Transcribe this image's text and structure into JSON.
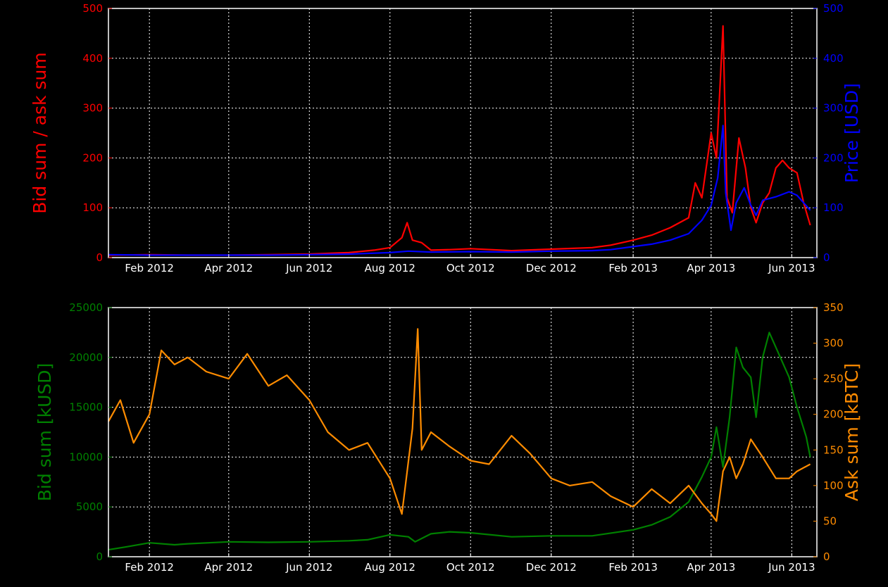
{
  "colors": {
    "background": "#000000",
    "frame": "#ffffff",
    "bid_ask_ratio": "#ff0000",
    "price": "#0000ff",
    "bid_sum": "#008000",
    "ask_sum": "#ff8c00",
    "grid": "#ffffff"
  },
  "chart_data": [
    {
      "type": "line",
      "ylabel_left": "Bid sum / ask sum",
      "ylabel_right": "Price [USD]",
      "x_tick_labels": [
        "Feb 2012",
        "Apr 2012",
        "Jun 2012",
        "Aug 2012",
        "Oct 2012",
        "Dec 2012",
        "Feb 2013",
        "Apr 2013",
        "Jun 2013"
      ],
      "x_ticks": [
        "2012-02-01",
        "2012-04-01",
        "2012-06-01",
        "2012-08-01",
        "2012-10-01",
        "2012-12-01",
        "2013-02-01",
        "2013-04-01",
        "2013-06-01"
      ],
      "xlim": [
        "2012-01-01",
        "2013-06-20"
      ],
      "ylim_left": [
        0,
        500
      ],
      "ylim_right": [
        0,
        500
      ],
      "y_ticks_left": [
        0,
        100,
        200,
        300,
        400,
        500
      ],
      "y_ticks_right": [
        0,
        100,
        200,
        300,
        400,
        500
      ],
      "grid": true,
      "series": [
        {
          "axis": "left",
          "color": "#ff0000",
          "points": [
            [
              "2012-01-01",
              5
            ],
            [
              "2012-02-01",
              6
            ],
            [
              "2012-03-01",
              5
            ],
            [
              "2012-04-01",
              5
            ],
            [
              "2012-05-01",
              6
            ],
            [
              "2012-06-01",
              7
            ],
            [
              "2012-07-01",
              10
            ],
            [
              "2012-07-20",
              15
            ],
            [
              "2012-08-01",
              20
            ],
            [
              "2012-08-10",
              40
            ],
            [
              "2012-08-14",
              70
            ],
            [
              "2012-08-18",
              35
            ],
            [
              "2012-08-25",
              30
            ],
            [
              "2012-09-01",
              15
            ],
            [
              "2012-09-15",
              16
            ],
            [
              "2012-10-01",
              18
            ],
            [
              "2012-11-01",
              14
            ],
            [
              "2012-12-01",
              17
            ],
            [
              "2013-01-01",
              20
            ],
            [
              "2013-01-15",
              25
            ],
            [
              "2013-02-01",
              35
            ],
            [
              "2013-02-15",
              45
            ],
            [
              "2013-03-01",
              60
            ],
            [
              "2013-03-15",
              80
            ],
            [
              "2013-03-20",
              150
            ],
            [
              "2013-03-25",
              120
            ],
            [
              "2013-04-01",
              250
            ],
            [
              "2013-04-05",
              200
            ],
            [
              "2013-04-10",
              465
            ],
            [
              "2013-04-13",
              120
            ],
            [
              "2013-04-17",
              90
            ],
            [
              "2013-04-22",
              240
            ],
            [
              "2013-04-27",
              180
            ],
            [
              "2013-05-01",
              100
            ],
            [
              "2013-05-05",
              70
            ],
            [
              "2013-05-10",
              110
            ],
            [
              "2013-05-15",
              130
            ],
            [
              "2013-05-20",
              180
            ],
            [
              "2013-05-25",
              195
            ],
            [
              "2013-05-30",
              180
            ],
            [
              "2013-06-05",
              170
            ],
            [
              "2013-06-10",
              110
            ],
            [
              "2013-06-15",
              65
            ]
          ]
        },
        {
          "axis": "right",
          "color": "#0000ff",
          "points": [
            [
              "2012-01-01",
              6
            ],
            [
              "2012-02-01",
              5
            ],
            [
              "2012-03-01",
              5
            ],
            [
              "2012-04-01",
              5
            ],
            [
              "2012-05-01",
              5
            ],
            [
              "2012-06-01",
              6
            ],
            [
              "2012-07-01",
              7
            ],
            [
              "2012-08-01",
              10
            ],
            [
              "2012-08-15",
              13
            ],
            [
              "2012-09-01",
              11
            ],
            [
              "2012-10-01",
              12
            ],
            [
              "2012-11-01",
              11
            ],
            [
              "2012-12-01",
              13
            ],
            [
              "2013-01-01",
              14
            ],
            [
              "2013-01-15",
              16
            ],
            [
              "2013-02-01",
              22
            ],
            [
              "2013-02-15",
              27
            ],
            [
              "2013-03-01",
              35
            ],
            [
              "2013-03-15",
              48
            ],
            [
              "2013-03-25",
              75
            ],
            [
              "2013-04-01",
              105
            ],
            [
              "2013-04-06",
              160
            ],
            [
              "2013-04-10",
              265
            ],
            [
              "2013-04-12",
              130
            ],
            [
              "2013-04-16",
              55
            ],
            [
              "2013-04-20",
              110
            ],
            [
              "2013-04-26",
              140
            ],
            [
              "2013-05-01",
              105
            ],
            [
              "2013-05-05",
              85
            ],
            [
              "2013-05-10",
              115
            ],
            [
              "2013-05-20",
              122
            ],
            [
              "2013-05-30",
              132
            ],
            [
              "2013-06-05",
              125
            ],
            [
              "2013-06-10",
              110
            ],
            [
              "2013-06-15",
              95
            ]
          ]
        }
      ]
    },
    {
      "type": "line",
      "ylabel_left": "Bid sum [kUSD]",
      "ylabel_right": "Ask sum [kBTC]",
      "x_tick_labels": [
        "Feb 2012",
        "Apr 2012",
        "Jun 2012",
        "Aug 2012",
        "Oct 2012",
        "Dec 2012",
        "Feb 2013",
        "Apr 2013",
        "Jun 2013"
      ],
      "x_ticks": [
        "2012-02-01",
        "2012-04-01",
        "2012-06-01",
        "2012-08-01",
        "2012-10-01",
        "2012-12-01",
        "2013-02-01",
        "2013-04-01",
        "2013-06-01"
      ],
      "xlim": [
        "2012-01-01",
        "2013-06-20"
      ],
      "ylim_left": [
        0,
        25000
      ],
      "ylim_right": [
        0,
        350
      ],
      "y_ticks_left": [
        0,
        5000,
        10000,
        15000,
        20000,
        25000
      ],
      "y_ticks_right": [
        0,
        50,
        100,
        150,
        200,
        250,
        300,
        350
      ],
      "grid": true,
      "series": [
        {
          "axis": "left",
          "color": "#008000",
          "points": [
            [
              "2012-01-01",
              700
            ],
            [
              "2012-01-15",
              1000
            ],
            [
              "2012-02-01",
              1400
            ],
            [
              "2012-02-20",
              1200
            ],
            [
              "2012-03-01",
              1300
            ],
            [
              "2012-04-01",
              1500
            ],
            [
              "2012-05-01",
              1450
            ],
            [
              "2012-06-01",
              1500
            ],
            [
              "2012-07-01",
              1600
            ],
            [
              "2012-07-15",
              1700
            ],
            [
              "2012-08-01",
              2200
            ],
            [
              "2012-08-15",
              2000
            ],
            [
              "2012-08-20",
              1500
            ],
            [
              "2012-09-01",
              2300
            ],
            [
              "2012-09-15",
              2500
            ],
            [
              "2012-10-01",
              2400
            ],
            [
              "2012-11-01",
              2000
            ],
            [
              "2012-12-01",
              2100
            ],
            [
              "2013-01-01",
              2100
            ],
            [
              "2013-02-01",
              2700
            ],
            [
              "2013-02-15",
              3200
            ],
            [
              "2013-03-01",
              4000
            ],
            [
              "2013-03-15",
              5500
            ],
            [
              "2013-03-25",
              8000
            ],
            [
              "2013-04-01",
              10000
            ],
            [
              "2013-04-05",
              13000
            ],
            [
              "2013-04-10",
              9000
            ],
            [
              "2013-04-15",
              14000
            ],
            [
              "2013-04-20",
              21000
            ],
            [
              "2013-04-25",
              19000
            ],
            [
              "2013-05-01",
              18000
            ],
            [
              "2013-05-05",
              14000
            ],
            [
              "2013-05-10",
              20000
            ],
            [
              "2013-05-15",
              22500
            ],
            [
              "2013-05-20",
              21000
            ],
            [
              "2013-05-30",
              18000
            ],
            [
              "2013-06-05",
              15000
            ],
            [
              "2013-06-12",
              12000
            ],
            [
              "2013-06-15",
              10000
            ]
          ]
        },
        {
          "axis": "right",
          "color": "#ff8c00",
          "points": [
            [
              "2012-01-01",
              190
            ],
            [
              "2012-01-10",
              220
            ],
            [
              "2012-01-20",
              160
            ],
            [
              "2012-02-01",
              200
            ],
            [
              "2012-02-10",
              290
            ],
            [
              "2012-02-20",
              270
            ],
            [
              "2012-03-01",
              280
            ],
            [
              "2012-03-15",
              260
            ],
            [
              "2012-04-01",
              250
            ],
            [
              "2012-04-15",
              285
            ],
            [
              "2012-05-01",
              240
            ],
            [
              "2012-05-15",
              255
            ],
            [
              "2012-06-01",
              220
            ],
            [
              "2012-06-15",
              175
            ],
            [
              "2012-07-01",
              150
            ],
            [
              "2012-07-15",
              160
            ],
            [
              "2012-08-01",
              110
            ],
            [
              "2012-08-10",
              60
            ],
            [
              "2012-08-18",
              180
            ],
            [
              "2012-08-22",
              320
            ],
            [
              "2012-08-25",
              150
            ],
            [
              "2012-09-01",
              175
            ],
            [
              "2012-09-15",
              155
            ],
            [
              "2012-10-01",
              135
            ],
            [
              "2012-10-15",
              130
            ],
            [
              "2012-11-01",
              170
            ],
            [
              "2012-11-15",
              145
            ],
            [
              "2012-12-01",
              110
            ],
            [
              "2012-12-15",
              100
            ],
            [
              "2013-01-01",
              105
            ],
            [
              "2013-01-15",
              85
            ],
            [
              "2013-02-01",
              70
            ],
            [
              "2013-02-15",
              95
            ],
            [
              "2013-03-01",
              75
            ],
            [
              "2013-03-15",
              100
            ],
            [
              "2013-03-25",
              75
            ],
            [
              "2013-04-01",
              60
            ],
            [
              "2013-04-05",
              50
            ],
            [
              "2013-04-10",
              120
            ],
            [
              "2013-04-15",
              140
            ],
            [
              "2013-04-20",
              110
            ],
            [
              "2013-04-25",
              130
            ],
            [
              "2013-05-01",
              165
            ],
            [
              "2013-05-10",
              140
            ],
            [
              "2013-05-20",
              110
            ],
            [
              "2013-05-30",
              110
            ],
            [
              "2013-06-05",
              120
            ],
            [
              "2013-06-15",
              130
            ]
          ]
        }
      ]
    }
  ]
}
